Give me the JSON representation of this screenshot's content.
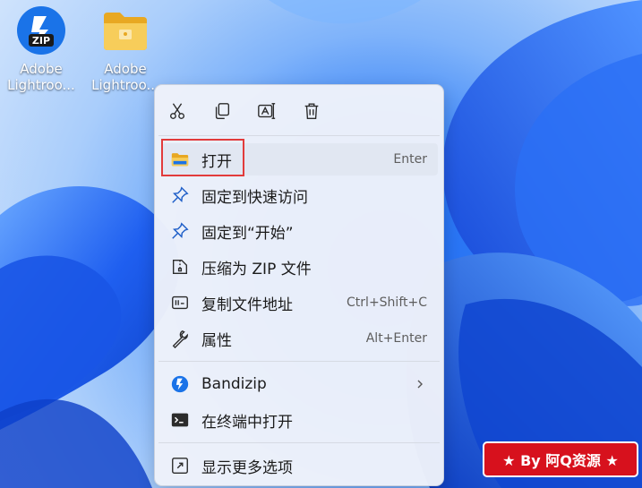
{
  "desktop": {
    "icons": [
      {
        "label_line1": "Adobe",
        "label_line2": "Lightroo..."
      },
      {
        "label_line1": "Adobe",
        "label_line2": "Lightroo..."
      }
    ]
  },
  "context_menu": {
    "toolbar": [
      {
        "icon": "cut-icon"
      },
      {
        "icon": "copy-icon"
      },
      {
        "icon": "rename-icon"
      },
      {
        "icon": "delete-icon"
      }
    ],
    "items": [
      {
        "label": "打开",
        "shortcut": "Enter",
        "icon": "folder-icon"
      },
      {
        "label": "固定到快速访问",
        "shortcut": "",
        "icon": "pin-icon"
      },
      {
        "label": "固定到“开始”",
        "shortcut": "",
        "icon": "pin-icon"
      },
      {
        "label": "压缩为 ZIP 文件",
        "shortcut": "",
        "icon": "zip-file-icon"
      },
      {
        "label": "复制文件地址",
        "shortcut": "Ctrl+Shift+C",
        "icon": "copy-path-icon"
      },
      {
        "label": "属性",
        "shortcut": "Alt+Enter",
        "icon": "wrench-icon"
      },
      {
        "label": "Bandizip",
        "shortcut": "",
        "icon": "bandizip-icon"
      },
      {
        "label": "在终端中打开",
        "shortcut": "",
        "icon": "terminal-icon"
      },
      {
        "label": "显示更多选项",
        "shortcut": "",
        "icon": "more-options-icon"
      }
    ]
  },
  "watermark": {
    "text": "★ By 阿Q资源 ★"
  },
  "colors": {
    "highlight": "#e23b3b",
    "watermark_bg": "#d7111d",
    "accent_blue": "#1f67f0",
    "folder_yellow": "#f5c24a"
  }
}
